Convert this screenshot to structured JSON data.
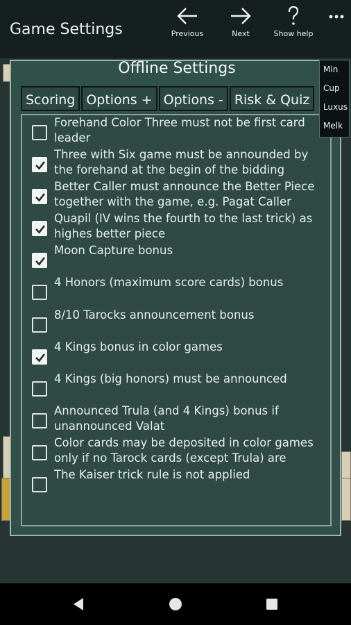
{
  "toolbar": {
    "title": "Game Settings",
    "previous_label": "Previous",
    "next_label": "Next",
    "help_label": "Show help",
    "overflow_icon": "overflow-menu-icon"
  },
  "panel": {
    "title": "Offline Settings",
    "tabs": [
      "Scoring",
      "Options +",
      "Options -",
      "Risk & Quiz"
    ]
  },
  "options": [
    {
      "label": "Forehand Color Three must not be first card leader",
      "checked": false
    },
    {
      "label": "Three with Six game must be announded by the forehand at the begin of the bidding",
      "checked": true
    },
    {
      "label": "Better Caller must announce the Better Piece together with the game, e.g. Pagat Caller",
      "checked": true
    },
    {
      "label": "Quapil (IV wins the fourth to the last trick) as highes better piece",
      "checked": true
    },
    {
      "label": "Moon Capture bonus",
      "checked": true
    },
    {
      "label": "4 Honors (maximum score cards) bonus",
      "checked": false
    },
    {
      "label": "8/10 Tarocks announcement bonus",
      "checked": false
    },
    {
      "label": "4 Kings bonus in color games",
      "checked": true
    },
    {
      "label": "4 Kings (big honors) must be announced",
      "checked": false
    },
    {
      "label": "Announced Trula (and 4 Kings) bonus if unannounced Valat",
      "checked": false
    },
    {
      "label": "Color cards may be deposited in color games only if no Tarock cards (except Trula) are",
      "checked": false
    },
    {
      "label": "The Kaiser trick rule is not applied",
      "checked": false
    }
  ],
  "context_menu": [
    "Min",
    "Cup",
    "Luxus",
    "Melk"
  ],
  "colors": {
    "panel": "#32504a",
    "toolbar": "#15201e",
    "checkbox_on": "#f2f5f4"
  }
}
